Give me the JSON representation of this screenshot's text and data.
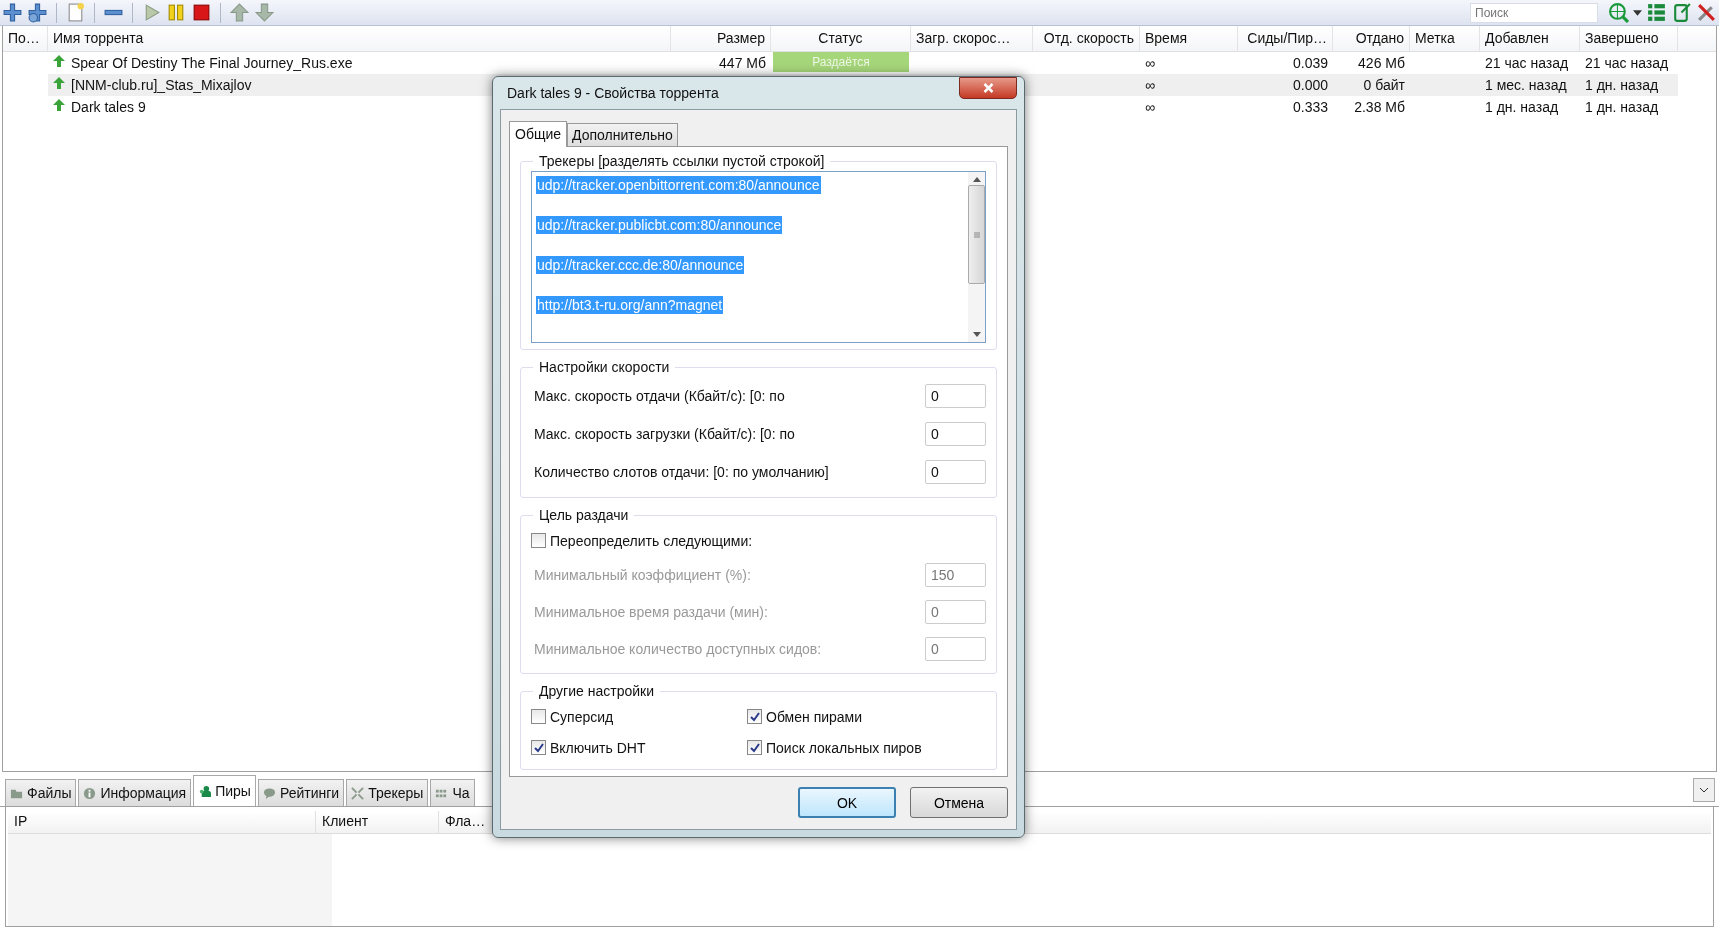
{
  "toolbar": {
    "search": {
      "placeholder": "Поиск"
    }
  },
  "table": {
    "columns": [
      "По…",
      "Имя торрента",
      "Размер",
      "Статус",
      "Загр. скорос…",
      "Отд. скорость",
      "Время",
      "Сиды/Пир…",
      "Отдано",
      "Метка",
      "Добавлен",
      "Завершено"
    ],
    "rows": [
      {
        "name": "Spear Of Destiny The Final Journey_Rus.exe",
        "size": "447 Мб",
        "status": "Раздаётся",
        "time": "∞",
        "ratio": "0.039",
        "uploaded": "426 Мб",
        "added": "21 час назад",
        "completed": "21 час назад"
      },
      {
        "name": "[NNM-club.ru]_Stas_Mixajlov",
        "time": "∞",
        "ratio": "0.000",
        "uploaded": "0 байт",
        "added": "1 мес. назад",
        "completed": "1 дн. назад"
      },
      {
        "name": "Dark tales 9",
        "time": "∞",
        "ratio": "0.333",
        "uploaded": "2.38 Мб",
        "added": "1 дн. назад",
        "completed": "1 дн. назад"
      }
    ]
  },
  "bottom_tabs": [
    {
      "label": "Файлы",
      "kind": "folder",
      "selected": false
    },
    {
      "label": "Информация",
      "kind": "info",
      "selected": false
    },
    {
      "label": "Пиры",
      "kind": "peers",
      "selected": true
    },
    {
      "label": "Рейтинги",
      "kind": "speech",
      "selected": false
    },
    {
      "label": "Трекеры",
      "kind": "trackers",
      "selected": false
    },
    {
      "label": "Ча",
      "kind": "grid",
      "selected": false
    }
  ],
  "peers_table": {
    "columns": [
      "IP",
      "Клиент",
      "Фла…"
    ]
  },
  "dialog": {
    "title": "Dark tales 9 - Свойства торрента",
    "tabs": [
      {
        "label": "Общие",
        "selected": true
      },
      {
        "label": "Дополнительно",
        "selected": false
      }
    ],
    "trackers": {
      "legend": "Трекеры [разделять ссылки пустой строкой]",
      "urls": [
        "udp://tracker.openbittorrent.com:80/announce",
        "udp://tracker.publicbt.com:80/announce",
        "udp://tracker.ccc.de:80/announce",
        "http://bt3.t-ru.org/ann?magnet"
      ]
    },
    "speed": {
      "legend": "Настройки скорости",
      "fields": [
        {
          "label": "Макс. скорость отдачи (Кбайт/с): [0: по",
          "value": "0"
        },
        {
          "label": "Макс. скорость загрузки (Кбайт/с): [0: по",
          "value": "0"
        },
        {
          "label": "Количество слотов отдачи: [0: по умолчанию]",
          "value": "0"
        }
      ]
    },
    "seeding": {
      "legend": "Цель раздачи",
      "override": {
        "label": "Переопределить следующими:",
        "checked": false
      },
      "fields": [
        {
          "label": "Минимальный коэффициент (%):",
          "value": "150",
          "disabled": true
        },
        {
          "label": "Минимальное время раздачи (мин):",
          "value": "0",
          "disabled": true
        },
        {
          "label": "Минимальное количество доступных сидов:",
          "value": "0",
          "disabled": true
        }
      ]
    },
    "other": {
      "legend": "Другие настройки",
      "options": [
        {
          "label": "Суперсид",
          "checked": false
        },
        {
          "label": "Обмен пирами",
          "checked": true
        },
        {
          "label": "Включить DHT",
          "checked": true
        },
        {
          "label": "Поиск локальных пиров",
          "checked": true
        }
      ]
    },
    "buttons": [
      {
        "label": "OK",
        "kind": "default"
      },
      {
        "label": "Отмена",
        "kind": "normal"
      }
    ]
  }
}
